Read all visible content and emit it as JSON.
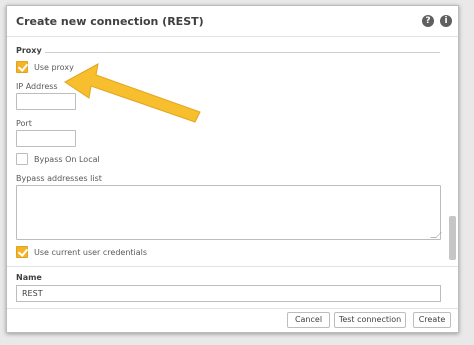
{
  "dialog": {
    "title": "Create new connection (REST)",
    "help_icon": "question-icon",
    "info_icon": "info-icon"
  },
  "proxy": {
    "section_label": "Proxy",
    "use_proxy_label": "Use proxy",
    "use_proxy_checked": true,
    "ip_label": "IP Address",
    "ip_value": "",
    "port_label": "Port",
    "port_value": "",
    "bypass_local_label": "Bypass On Local",
    "bypass_local_checked": false,
    "bypass_list_label": "Bypass addresses list",
    "bypass_list_value": ""
  },
  "credentials": {
    "use_current_label": "Use current user credentials",
    "use_current_checked": true
  },
  "name": {
    "label": "Name",
    "value": "REST"
  },
  "buttons": {
    "cancel": "Cancel",
    "test": "Test connection",
    "create": "Create"
  },
  "colors": {
    "accent": "#f5b32a",
    "arrow": "#f7be2d"
  }
}
